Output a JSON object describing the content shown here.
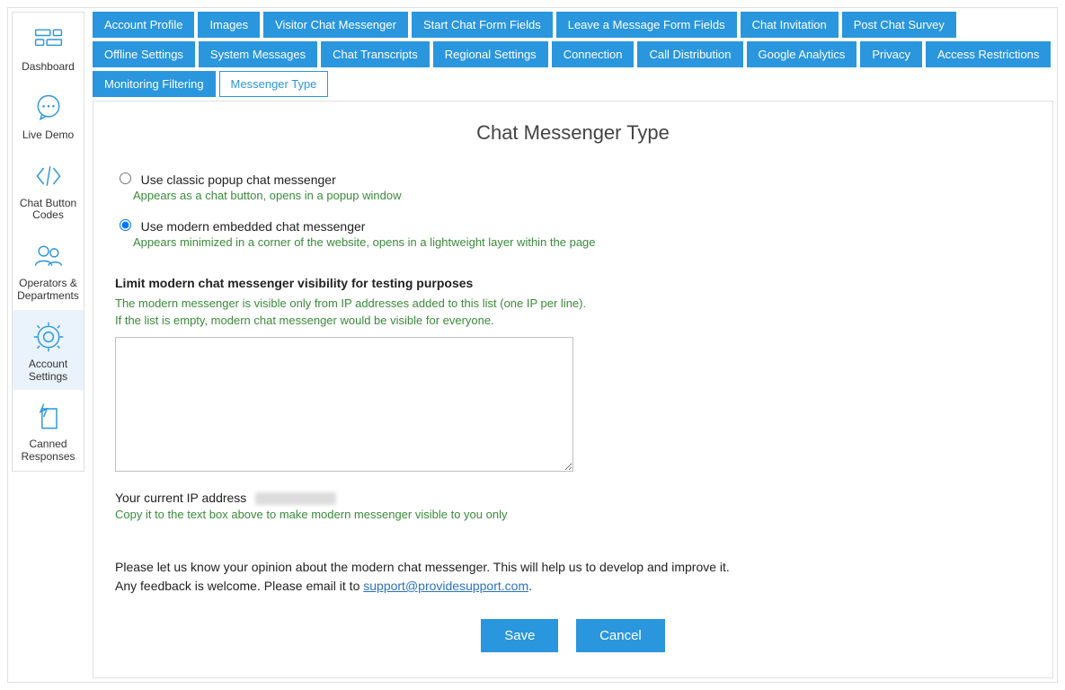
{
  "sidebar": {
    "items": [
      {
        "label": "Dashboard"
      },
      {
        "label": "Live Demo"
      },
      {
        "label": "Chat Button Codes"
      },
      {
        "label": "Operators & Departments"
      },
      {
        "label": "Account Settings"
      },
      {
        "label": "Canned Responses"
      }
    ]
  },
  "tabs": [
    "Account Profile",
    "Images",
    "Visitor Chat Messenger",
    "Start Chat Form Fields",
    "Leave a Message Form Fields",
    "Chat Invitation",
    "Post Chat Survey",
    "Offline Settings",
    "System Messages",
    "Chat Transcripts",
    "Regional Settings",
    "Connection",
    "Call Distribution",
    "Google Analytics",
    "Privacy",
    "Access Restrictions",
    "Monitoring Filtering",
    "Messenger Type"
  ],
  "active_tab": "Messenger Type",
  "page": {
    "title": "Chat Messenger Type",
    "option_classic": {
      "label": "Use classic popup chat messenger",
      "hint": "Appears as a chat button, opens in a popup window",
      "checked": false
    },
    "option_modern": {
      "label": "Use modern embedded chat messenger",
      "hint": "Appears minimized in a corner of the website, opens in a lightweight layer within the page",
      "checked": true
    },
    "limit_heading": "Limit modern chat messenger visibility for testing purposes",
    "limit_help_1": "The modern messenger is visible only from IP addresses added to this list (one IP per line).",
    "limit_help_2": "If the list is empty, modern chat messenger would be visible for everyone.",
    "ip_textarea_value": "",
    "current_ip_label": "Your current IP address",
    "copy_hint": "Copy it to the text box above to make modern messenger visible to you only",
    "feedback_1": "Please let us know your opinion about the modern chat messenger. This will help us to develop and improve it.",
    "feedback_2a": "Any feedback is welcome. Please email it to ",
    "feedback_email": "support@providesupport.com",
    "feedback_2b": ".",
    "save_label": "Save",
    "cancel_label": "Cancel"
  }
}
